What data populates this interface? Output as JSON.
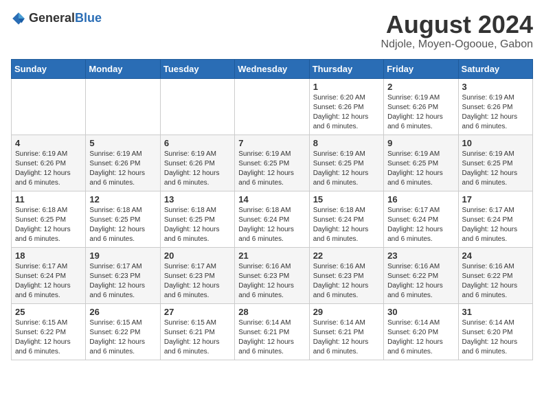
{
  "header": {
    "logo_general": "General",
    "logo_blue": "Blue",
    "title": "August 2024",
    "subtitle": "Ndjole, Moyen-Ogooue, Gabon"
  },
  "weekdays": [
    "Sunday",
    "Monday",
    "Tuesday",
    "Wednesday",
    "Thursday",
    "Friday",
    "Saturday"
  ],
  "weeks": [
    [
      {
        "day": "",
        "info": ""
      },
      {
        "day": "",
        "info": ""
      },
      {
        "day": "",
        "info": ""
      },
      {
        "day": "",
        "info": ""
      },
      {
        "day": "1",
        "info": "Sunrise: 6:20 AM\nSunset: 6:26 PM\nDaylight: 12 hours and 6 minutes."
      },
      {
        "day": "2",
        "info": "Sunrise: 6:19 AM\nSunset: 6:26 PM\nDaylight: 12 hours and 6 minutes."
      },
      {
        "day": "3",
        "info": "Sunrise: 6:19 AM\nSunset: 6:26 PM\nDaylight: 12 hours and 6 minutes."
      }
    ],
    [
      {
        "day": "4",
        "info": "Sunrise: 6:19 AM\nSunset: 6:26 PM\nDaylight: 12 hours and 6 minutes."
      },
      {
        "day": "5",
        "info": "Sunrise: 6:19 AM\nSunset: 6:26 PM\nDaylight: 12 hours and 6 minutes."
      },
      {
        "day": "6",
        "info": "Sunrise: 6:19 AM\nSunset: 6:26 PM\nDaylight: 12 hours and 6 minutes."
      },
      {
        "day": "7",
        "info": "Sunrise: 6:19 AM\nSunset: 6:25 PM\nDaylight: 12 hours and 6 minutes."
      },
      {
        "day": "8",
        "info": "Sunrise: 6:19 AM\nSunset: 6:25 PM\nDaylight: 12 hours and 6 minutes."
      },
      {
        "day": "9",
        "info": "Sunrise: 6:19 AM\nSunset: 6:25 PM\nDaylight: 12 hours and 6 minutes."
      },
      {
        "day": "10",
        "info": "Sunrise: 6:19 AM\nSunset: 6:25 PM\nDaylight: 12 hours and 6 minutes."
      }
    ],
    [
      {
        "day": "11",
        "info": "Sunrise: 6:18 AM\nSunset: 6:25 PM\nDaylight: 12 hours and 6 minutes."
      },
      {
        "day": "12",
        "info": "Sunrise: 6:18 AM\nSunset: 6:25 PM\nDaylight: 12 hours and 6 minutes."
      },
      {
        "day": "13",
        "info": "Sunrise: 6:18 AM\nSunset: 6:25 PM\nDaylight: 12 hours and 6 minutes."
      },
      {
        "day": "14",
        "info": "Sunrise: 6:18 AM\nSunset: 6:24 PM\nDaylight: 12 hours and 6 minutes."
      },
      {
        "day": "15",
        "info": "Sunrise: 6:18 AM\nSunset: 6:24 PM\nDaylight: 12 hours and 6 minutes."
      },
      {
        "day": "16",
        "info": "Sunrise: 6:17 AM\nSunset: 6:24 PM\nDaylight: 12 hours and 6 minutes."
      },
      {
        "day": "17",
        "info": "Sunrise: 6:17 AM\nSunset: 6:24 PM\nDaylight: 12 hours and 6 minutes."
      }
    ],
    [
      {
        "day": "18",
        "info": "Sunrise: 6:17 AM\nSunset: 6:24 PM\nDaylight: 12 hours and 6 minutes."
      },
      {
        "day": "19",
        "info": "Sunrise: 6:17 AM\nSunset: 6:23 PM\nDaylight: 12 hours and 6 minutes."
      },
      {
        "day": "20",
        "info": "Sunrise: 6:17 AM\nSunset: 6:23 PM\nDaylight: 12 hours and 6 minutes."
      },
      {
        "day": "21",
        "info": "Sunrise: 6:16 AM\nSunset: 6:23 PM\nDaylight: 12 hours and 6 minutes."
      },
      {
        "day": "22",
        "info": "Sunrise: 6:16 AM\nSunset: 6:23 PM\nDaylight: 12 hours and 6 minutes."
      },
      {
        "day": "23",
        "info": "Sunrise: 6:16 AM\nSunset: 6:22 PM\nDaylight: 12 hours and 6 minutes."
      },
      {
        "day": "24",
        "info": "Sunrise: 6:16 AM\nSunset: 6:22 PM\nDaylight: 12 hours and 6 minutes."
      }
    ],
    [
      {
        "day": "25",
        "info": "Sunrise: 6:15 AM\nSunset: 6:22 PM\nDaylight: 12 hours and 6 minutes."
      },
      {
        "day": "26",
        "info": "Sunrise: 6:15 AM\nSunset: 6:22 PM\nDaylight: 12 hours and 6 minutes."
      },
      {
        "day": "27",
        "info": "Sunrise: 6:15 AM\nSunset: 6:21 PM\nDaylight: 12 hours and 6 minutes."
      },
      {
        "day": "28",
        "info": "Sunrise: 6:14 AM\nSunset: 6:21 PM\nDaylight: 12 hours and 6 minutes."
      },
      {
        "day": "29",
        "info": "Sunrise: 6:14 AM\nSunset: 6:21 PM\nDaylight: 12 hours and 6 minutes."
      },
      {
        "day": "30",
        "info": "Sunrise: 6:14 AM\nSunset: 6:20 PM\nDaylight: 12 hours and 6 minutes."
      },
      {
        "day": "31",
        "info": "Sunrise: 6:14 AM\nSunset: 6:20 PM\nDaylight: 12 hours and 6 minutes."
      }
    ]
  ]
}
